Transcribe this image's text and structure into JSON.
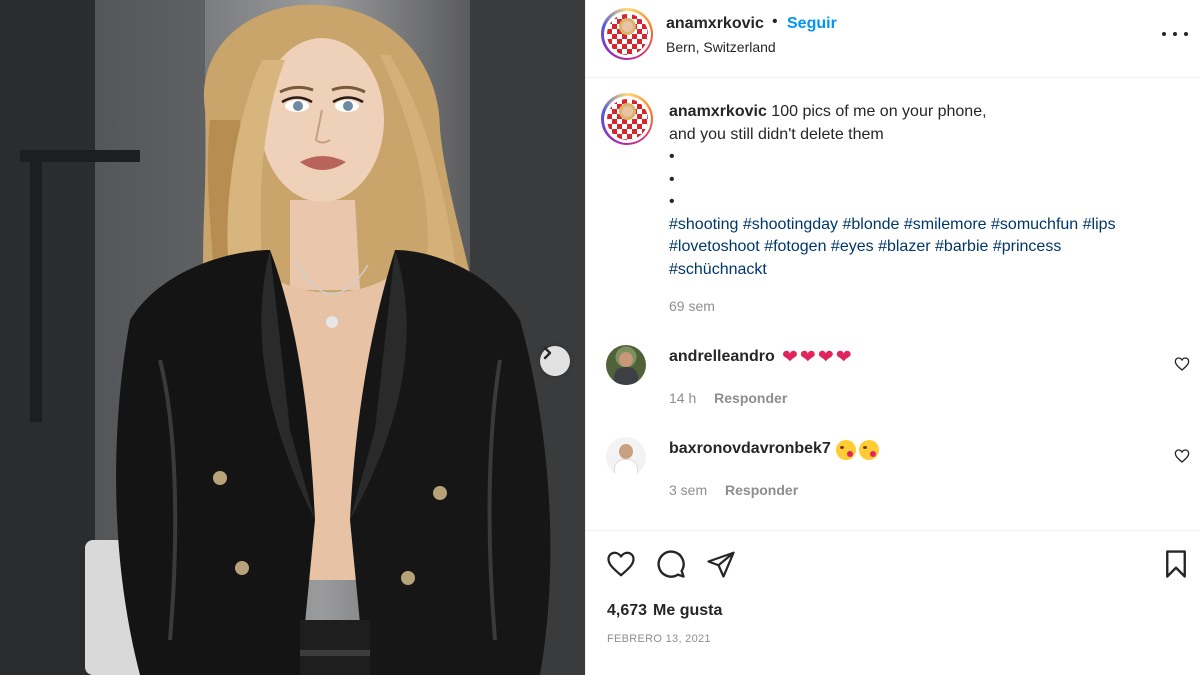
{
  "post": {
    "author": "anamxrkovic",
    "follow_label": "Seguir",
    "separator": "•",
    "location": "Bern, Switzerland",
    "caption": {
      "username": "anamxrkovic",
      "line1": "100 pics of me on your phone,",
      "line2": "and you still didn't delete them",
      "bullets": [
        "•",
        "•",
        "•"
      ],
      "hashtags": [
        "#shooting",
        "#shootingday",
        "#blonde",
        "#smilemore",
        "#somuchfun",
        "#lips",
        "#lovetoshoot",
        "#fotogen",
        "#eyes",
        "#blazer",
        "#barbie",
        "#princess",
        "#schüchnackt"
      ],
      "time": "69 sem"
    },
    "comments": [
      {
        "username": "andrelleandro",
        "emojis": "❤❤❤❤",
        "time": "14 h",
        "reply_label": "Responder"
      },
      {
        "username": "baxronovdavronbek7",
        "emojis": "😋😘",
        "time": "3 sem",
        "reply_label": "Responder"
      }
    ],
    "likes_count": "4,673",
    "likes_label": "Me gusta",
    "date": "FEBRERO 13, 2021"
  },
  "icons": {
    "next": "chevron-right-icon",
    "more": "more-options-icon",
    "like": "heart-icon",
    "comment": "comment-icon",
    "share": "send-icon",
    "save": "bookmark-icon"
  },
  "colors": {
    "link_blue": "#0095f6",
    "hashtag": "#00376b",
    "muted": "#8e8e8e",
    "heart_red": "#e0245e"
  }
}
